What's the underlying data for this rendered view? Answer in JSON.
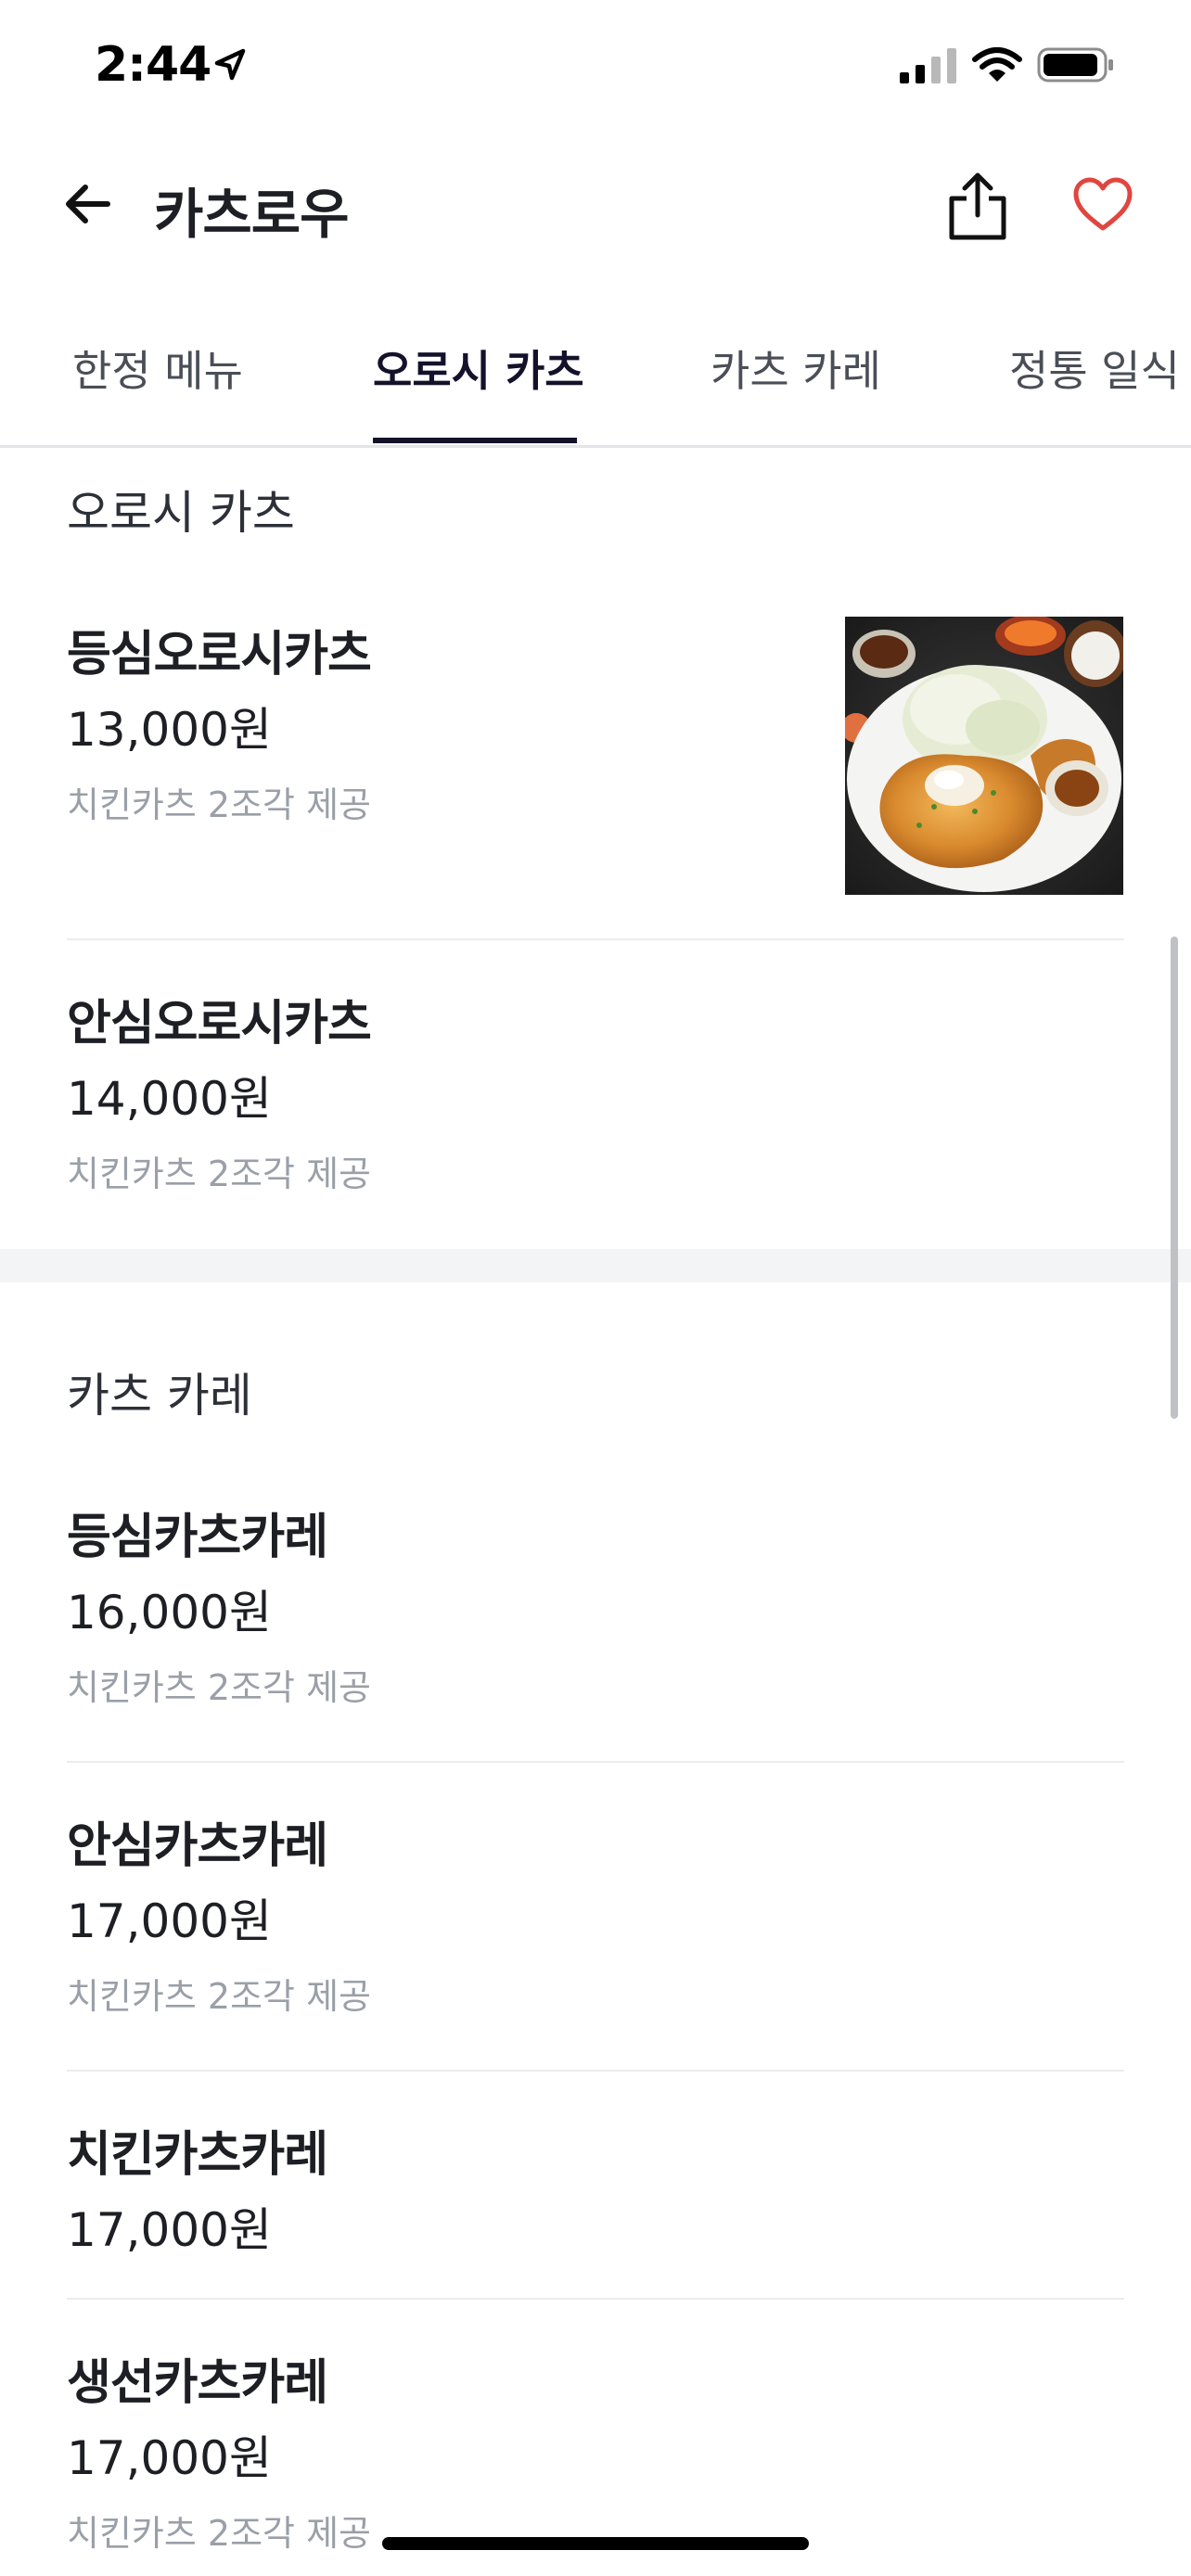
{
  "status_bar": {
    "time": "2:44"
  },
  "header": {
    "title": "카츠로우"
  },
  "tabs": [
    {
      "label": "한정 메뉴",
      "active": false
    },
    {
      "label": "오로시 카츠",
      "active": true
    },
    {
      "label": "카츠 카레",
      "active": false
    },
    {
      "label": "정통 일식",
      "active": false
    }
  ],
  "sections": [
    {
      "title": "오로시 카츠",
      "items": [
        {
          "name": "등심오로시카츠",
          "price": "13,000원",
          "description": "치킨카츠 2조각 제공",
          "has_image": true
        },
        {
          "name": "안심오로시카츠",
          "price": "14,000원",
          "description": "치킨카츠 2조각 제공",
          "has_image": false
        }
      ]
    },
    {
      "title": "카츠 카레",
      "items": [
        {
          "name": "등심카츠카레",
          "price": "16,000원",
          "description": "치킨카츠 2조각 제공",
          "has_image": false
        },
        {
          "name": "안심카츠카레",
          "price": "17,000원",
          "description": "치킨카츠 2조각 제공",
          "has_image": false
        },
        {
          "name": "치킨카츠카레",
          "price": "17,000원",
          "description": "",
          "has_image": false
        },
        {
          "name": "생선카츠카레",
          "price": "17,000원",
          "description": "치킨카츠 2조각 제공",
          "has_image": false
        }
      ]
    }
  ],
  "colors": {
    "accent": "#14112b",
    "heart": "#e0463f",
    "muted_text": "#9a9fa8"
  }
}
